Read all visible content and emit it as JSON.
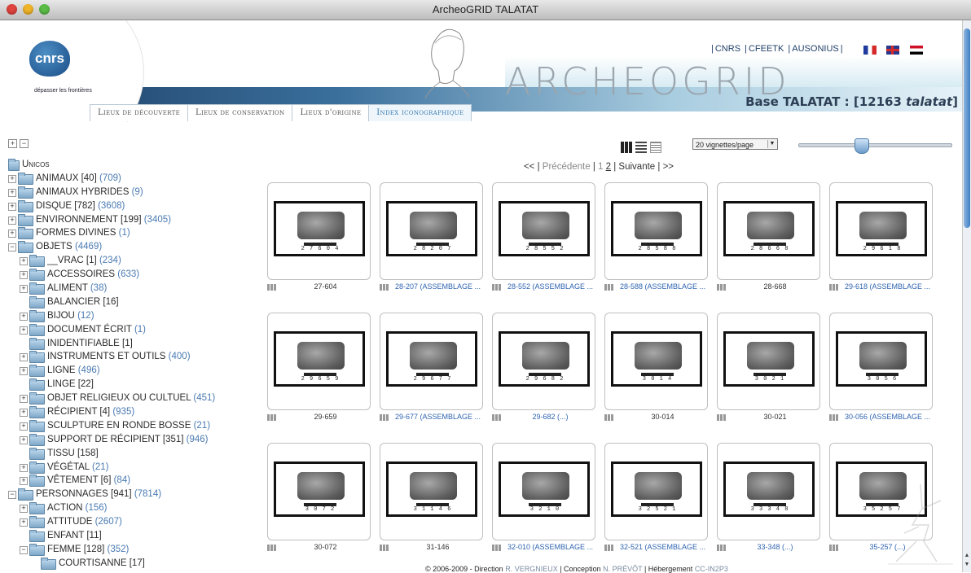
{
  "window": {
    "title": "ArcheoGRID TALATAT"
  },
  "header": {
    "cnrs_logo": "cnrs",
    "cnrs_tagline": "dépasser les frontières",
    "brand": "ARCHEOGRID",
    "toplinks": [
      "CNRS",
      "CFEETK",
      "AUSONIUS"
    ],
    "flags": [
      "fr-flag",
      "uk-flag",
      "eg-flag"
    ],
    "base_title_prefix": "Base TALATAT : [12163 ",
    "base_title_em": "talatat",
    "base_title_suffix": "]"
  },
  "tabs": [
    {
      "label": "Lieux de découverte",
      "active": false
    },
    {
      "label": "Lieux de conservation",
      "active": false
    },
    {
      "label": "Lieux d'origine",
      "active": false
    },
    {
      "label": "Index iconographique",
      "active": true
    }
  ],
  "tree": {
    "tools": [
      "+",
      "−"
    ],
    "root": "Unicos",
    "items": [
      {
        "level": 0,
        "pm": "+",
        "label": "ANIMAUX [40]",
        "count": "(709)"
      },
      {
        "level": 0,
        "pm": "+",
        "label": "ANIMAUX HYBRIDES",
        "count": "(9)"
      },
      {
        "level": 0,
        "pm": "+",
        "label": "DISQUE [782]",
        "count": "(3608)"
      },
      {
        "level": 0,
        "pm": "+",
        "label": "ENVIRONNEMENT [199]",
        "count": "(3405)"
      },
      {
        "level": 0,
        "pm": "+",
        "label": "FORMES DIVINES",
        "count": "(1)"
      },
      {
        "level": 0,
        "pm": "−",
        "label": "OBJETS",
        "count": "(4469)"
      },
      {
        "level": 1,
        "pm": "+",
        "label": "__VRAC [1]",
        "count": "(234)"
      },
      {
        "level": 1,
        "pm": "+",
        "label": "ACCESSOIRES",
        "count": "(633)"
      },
      {
        "level": 1,
        "pm": "+",
        "label": "ALIMENT",
        "count": "(38)"
      },
      {
        "level": 1,
        "pm": "",
        "label": "BALANCIER [16]",
        "count": ""
      },
      {
        "level": 1,
        "pm": "+",
        "label": "BIJOU",
        "count": "(12)"
      },
      {
        "level": 1,
        "pm": "+",
        "label": "DOCUMENT ÉCRIT",
        "count": "(1)"
      },
      {
        "level": 1,
        "pm": "",
        "label": "INIDENTIFIABLE [1]",
        "count": ""
      },
      {
        "level": 1,
        "pm": "+",
        "label": "INSTRUMENTS ET OUTILS",
        "count": "(400)"
      },
      {
        "level": 1,
        "pm": "+",
        "label": "LIGNE",
        "count": "(496)"
      },
      {
        "level": 1,
        "pm": "",
        "label": "LINGE [22]",
        "count": ""
      },
      {
        "level": 1,
        "pm": "+",
        "label": "OBJET RELIGIEUX OU CULTUEL",
        "count": "(451)"
      },
      {
        "level": 1,
        "pm": "+",
        "label": "RÉCIPIENT [4]",
        "count": "(935)"
      },
      {
        "level": 1,
        "pm": "+",
        "label": "SCULPTURE EN RONDE BOSSE",
        "count": "(21)"
      },
      {
        "level": 1,
        "pm": "+",
        "label": "SUPPORT DE RÉCIPIENT [351]",
        "count": "(946)"
      },
      {
        "level": 1,
        "pm": "",
        "label": "TISSU [158]",
        "count": ""
      },
      {
        "level": 1,
        "pm": "+",
        "label": "VÉGÉTAL",
        "count": "(21)"
      },
      {
        "level": 1,
        "pm": "+",
        "label": "VÊTEMENT [6]",
        "count": "(84)"
      },
      {
        "level": 0,
        "pm": "−",
        "label": "PERSONNAGES [941]",
        "count": "(7814)"
      },
      {
        "level": 1,
        "pm": "+",
        "label": "ACTION",
        "count": "(156)"
      },
      {
        "level": 1,
        "pm": "+",
        "label": "ATTITUDE",
        "count": "(2607)"
      },
      {
        "level": 1,
        "pm": "",
        "label": "ENFANT [11]",
        "count": ""
      },
      {
        "level": 1,
        "pm": "−",
        "label": "FEMME [128]",
        "count": "(352)"
      },
      {
        "level": 2,
        "pm": "",
        "label": "COURTISANNE [17]",
        "count": ""
      }
    ]
  },
  "controls": {
    "view_icons": [
      "grid-view-icon",
      "list-view-icon",
      "detail-view-icon"
    ],
    "per_page": "20 vignettes/page",
    "zoom_slider_level": 0.4
  },
  "pager": {
    "first": "<<",
    "prev": "Précédente",
    "page1": "1",
    "page2": "2",
    "next": "Suivante",
    "last": ">>"
  },
  "thumbnails": [
    {
      "caption": "27-604",
      "code": "2 7 6 0 4",
      "link": false
    },
    {
      "caption": "28-207 (ASSEMBLAGE ...",
      "code": "2 8 2 0 7",
      "link": true
    },
    {
      "caption": "28-552 (ASSEMBLAGE ...",
      "code": "2 8 5 5 2",
      "link": true
    },
    {
      "caption": "28-588 (ASSEMBLAGE ...",
      "code": "2 8 5 8 8",
      "link": true
    },
    {
      "caption": "28-668",
      "code": "2 8 6 6 8",
      "link": false
    },
    {
      "caption": "29-618 (ASSEMBLAGE ...",
      "code": "2 9 6 1 8",
      "link": true
    },
    {
      "caption": "29-659",
      "code": "2 9 6 5 9",
      "link": false
    },
    {
      "caption": "29-677 (ASSEMBLAGE ...",
      "code": "2 9 6 7 7",
      "link": true
    },
    {
      "caption": "29-682 (...)",
      "code": "2 9 6 8 2",
      "link": true
    },
    {
      "caption": "30-014",
      "code": "3 0 1 4",
      "link": false
    },
    {
      "caption": "30-021",
      "code": "3 0 2 1",
      "link": false
    },
    {
      "caption": "30-056 (ASSEMBLAGE ...",
      "code": "3 0 5 6",
      "link": true
    },
    {
      "caption": "30-072",
      "code": "3 0 7 2",
      "link": false
    },
    {
      "caption": "31-146",
      "code": "3 1 1 4 6",
      "link": false
    },
    {
      "caption": "32-010 (ASSEMBLAGE ...",
      "code": "3 2 1 0",
      "link": true
    },
    {
      "caption": "32-521 (ASSEMBLAGE ...",
      "code": "3 2 5 2 1",
      "link": true
    },
    {
      "caption": "33-348 (...)",
      "code": "3 3 3 4 8",
      "link": true
    },
    {
      "caption": "35-257 (...)",
      "code": "3 5 2 5 7",
      "link": true
    }
  ],
  "footer": {
    "prefix": "© 2006-2009 - Direction ",
    "director": "R. VERGNIEUX",
    "mid1": " | Conception ",
    "designer": "N. PRÉVÔT",
    "mid2": " | Hébergement ",
    "host": "CC-IN2P3"
  },
  "colors": {
    "accent": "#3a7ab0",
    "count": "#4a7ab2",
    "link": "#2f64b0"
  }
}
